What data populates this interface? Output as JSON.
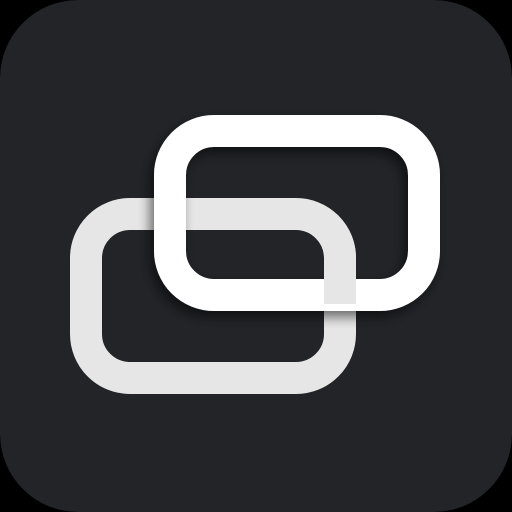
{
  "icon": {
    "glyph": "two-linked-rounded-rectangles-icon",
    "colors": {
      "background": "#222428",
      "outer": "#000000",
      "front_ring": "#ffffff",
      "back_ring": "#e6e6e6",
      "shadow": "#000000"
    }
  }
}
